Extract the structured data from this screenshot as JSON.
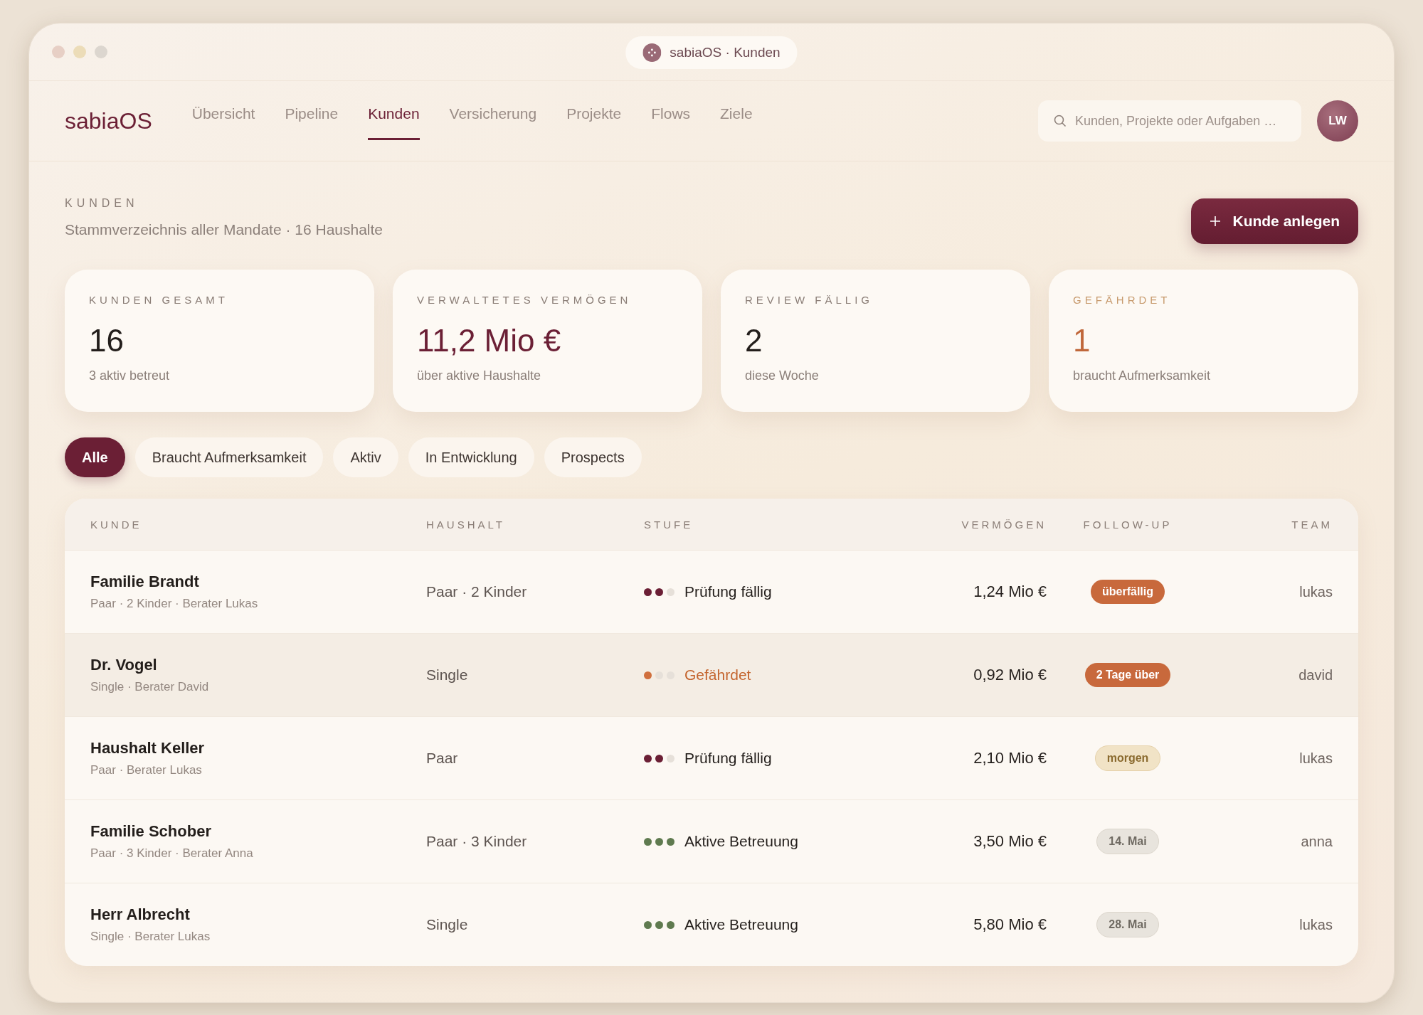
{
  "window": {
    "title": "sabiaOS · Kunden"
  },
  "nav": {
    "brand": "sabiaOS",
    "tabs": [
      {
        "label": "Übersicht",
        "selected": false
      },
      {
        "label": "Pipeline",
        "selected": false
      },
      {
        "label": "Kunden",
        "selected": true
      },
      {
        "label": "Versicherung",
        "selected": false
      },
      {
        "label": "Projekte",
        "selected": false
      },
      {
        "label": "Flows",
        "selected": false
      },
      {
        "label": "Ziele",
        "selected": false
      }
    ],
    "search": {
      "placeholder": "Kunden, Projekte oder Aufgaben …"
    },
    "avatar": "LW"
  },
  "header": {
    "eyebrow": "KUNDEN",
    "subtitle": "Stammverzeichnis aller Mandate · 16 Haushalte",
    "button": "Kunde anlegen"
  },
  "stats": [
    {
      "label": "KUNDEN GESAMT",
      "value": "16",
      "note": "3 aktiv betreut",
      "kind": "plain"
    },
    {
      "label": "VERWALTETES VERMÖGEN",
      "value": "11,2 Mio €",
      "note": "über aktive Haushalte",
      "kind": "accent"
    },
    {
      "label": "REVIEW FÄLLIG",
      "value": "2",
      "note": "diese Woche",
      "kind": "plain"
    },
    {
      "label": "GEFÄHRDET",
      "value": "1",
      "note": "braucht Aufmerksamkeit",
      "kind": "warning"
    }
  ],
  "filters": [
    {
      "label": "Alle",
      "selected": true
    },
    {
      "label": "Braucht Aufmerksamkeit",
      "selected": false
    },
    {
      "label": "Aktiv",
      "selected": false
    },
    {
      "label": "In Entwicklung",
      "selected": false
    },
    {
      "label": "Prospects",
      "selected": false
    }
  ],
  "table": {
    "columns": [
      "KUNDE",
      "HAUSHALT",
      "STUFE",
      "VERMÖGEN",
      "FOLLOW-UP",
      "TEAM"
    ],
    "rows": [
      {
        "name": "Familie Brandt",
        "detail": "Paar · 2 Kinder · Berater Lukas",
        "household": "Paar · 2 Kinder",
        "stage": {
          "label": "Prüfung fällig",
          "kind": "review"
        },
        "assets": "1,24 Mio €",
        "followup": {
          "label": "überfällig",
          "kind": "overdue"
        },
        "team": "lukas",
        "selected": false
      },
      {
        "name": "Dr. Vogel",
        "detail": "Single · Berater David",
        "household": "Single",
        "stage": {
          "label": "Gefährdet",
          "kind": "risk"
        },
        "assets": "0,92 Mio €",
        "followup": {
          "label": "2 Tage über",
          "kind": "overdue"
        },
        "team": "david",
        "selected": true
      },
      {
        "name": "Haushalt Keller",
        "detail": "Paar · Berater Lukas",
        "household": "Paar",
        "stage": {
          "label": "Prüfung fällig",
          "kind": "review"
        },
        "assets": "2,10 Mio €",
        "followup": {
          "label": "morgen",
          "kind": "soon"
        },
        "team": "lukas",
        "selected": false
      },
      {
        "name": "Familie Schober",
        "detail": "Paar · 3 Kinder · Berater Anna",
        "household": "Paar · 3 Kinder",
        "stage": {
          "label": "Aktive Betreuung",
          "kind": "active"
        },
        "assets": "3,50 Mio €",
        "followup": {
          "label": "14. Mai",
          "kind": "date"
        },
        "team": "anna",
        "selected": false
      },
      {
        "name": "Herr Albrecht",
        "detail": "Single · Berater Lukas",
        "household": "Single",
        "stage": {
          "label": "Aktive Betreuung",
          "kind": "active"
        },
        "assets": "5,80 Mio €",
        "followup": {
          "label": "28. Mai",
          "kind": "date"
        },
        "team": "lukas",
        "selected": false
      }
    ]
  }
}
